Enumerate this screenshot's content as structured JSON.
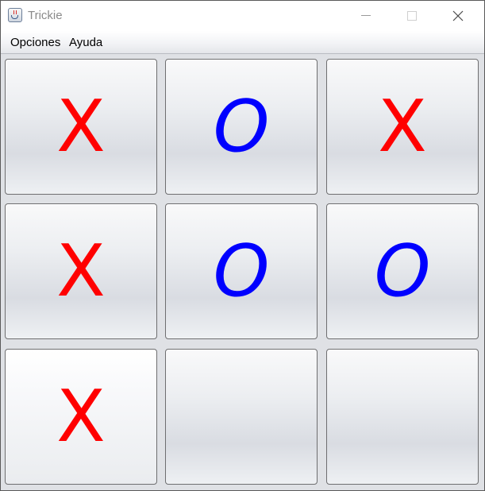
{
  "window": {
    "title": "Trickie"
  },
  "menubar": {
    "items": [
      "Opciones",
      "Ayuda"
    ]
  },
  "board": {
    "cells": [
      "X",
      "O",
      "X",
      "X",
      "O",
      "O",
      "X",
      "",
      ""
    ]
  },
  "colors": {
    "x_mark": "#ff0000",
    "o_mark": "#0000ff"
  }
}
